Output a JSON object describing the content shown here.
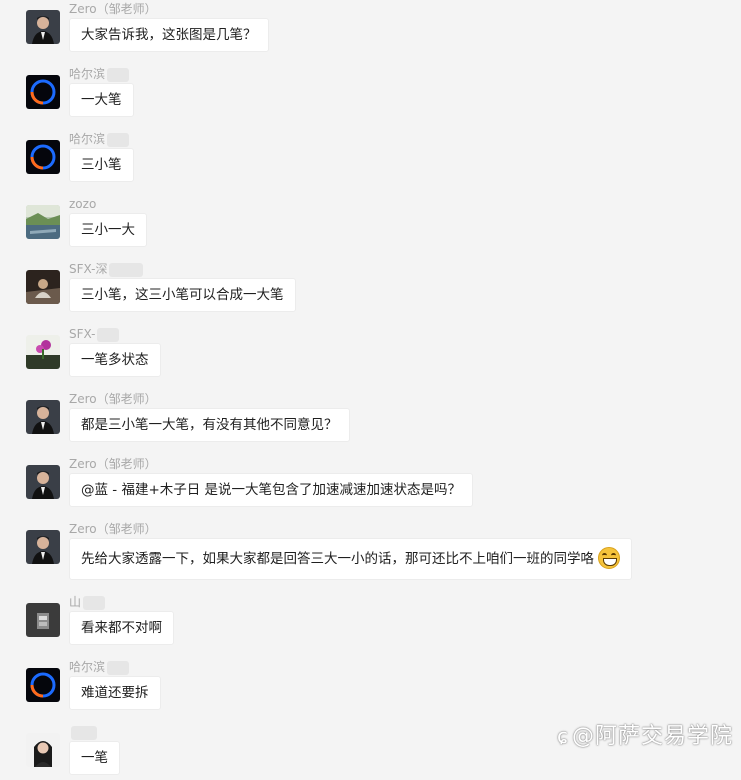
{
  "messages": [
    {
      "sender": "Zero（邹老师）",
      "avatar": "man-portrait-avatar",
      "text": "大家告诉我，这张图是几笔？"
    },
    {
      "sender": "哈尔滨",
      "avatar": "blue-ring-avatar",
      "text": "一大笔"
    },
    {
      "sender": "哈尔滨",
      "avatar": "blue-ring-avatar",
      "text": "三小笔"
    },
    {
      "sender": "zozo",
      "avatar": "landscape-avatar",
      "text": "三小一大"
    },
    {
      "sender": "SFX-深",
      "avatar": "dark-photo-avatar",
      "text": "三小笔，这三小笔可以合成一大笔"
    },
    {
      "sender": "SFX-",
      "avatar": "flower-avatar",
      "text": "一笔多状态"
    },
    {
      "sender": "Zero（邹老师）",
      "avatar": "man-portrait-avatar",
      "text": "都是三小笔一大笔，有没有其他不同意见？"
    },
    {
      "sender": "Zero（邹老师）",
      "avatar": "man-portrait-avatar",
      "text": "@蓝  -  福建+木子日 是说一大笔包含了加速减速加速状态是吗？"
    },
    {
      "sender": "Zero（邹老师）",
      "avatar": "man-portrait-avatar",
      "text": "先给大家透露一下，如果大家都是回答三大一小的话，那可还比不上咱们一班的同学咯"
    },
    {
      "sender": "山",
      "avatar": "dark-photo-avatar",
      "text": "看来都不对啊"
    },
    {
      "sender": "哈尔滨",
      "avatar": "blue-ring-avatar",
      "text": "难道还要拆"
    },
    {
      "sender": "",
      "avatar": "woman-portrait-avatar",
      "text": "一笔"
    }
  ],
  "watermark": {
    "icon": "weibo-icon",
    "text": "@阿萨交易学院"
  },
  "colors": {
    "background": "#f4f4f4",
    "bubble": "#ffffff",
    "sender": "#a8a8a8"
  }
}
